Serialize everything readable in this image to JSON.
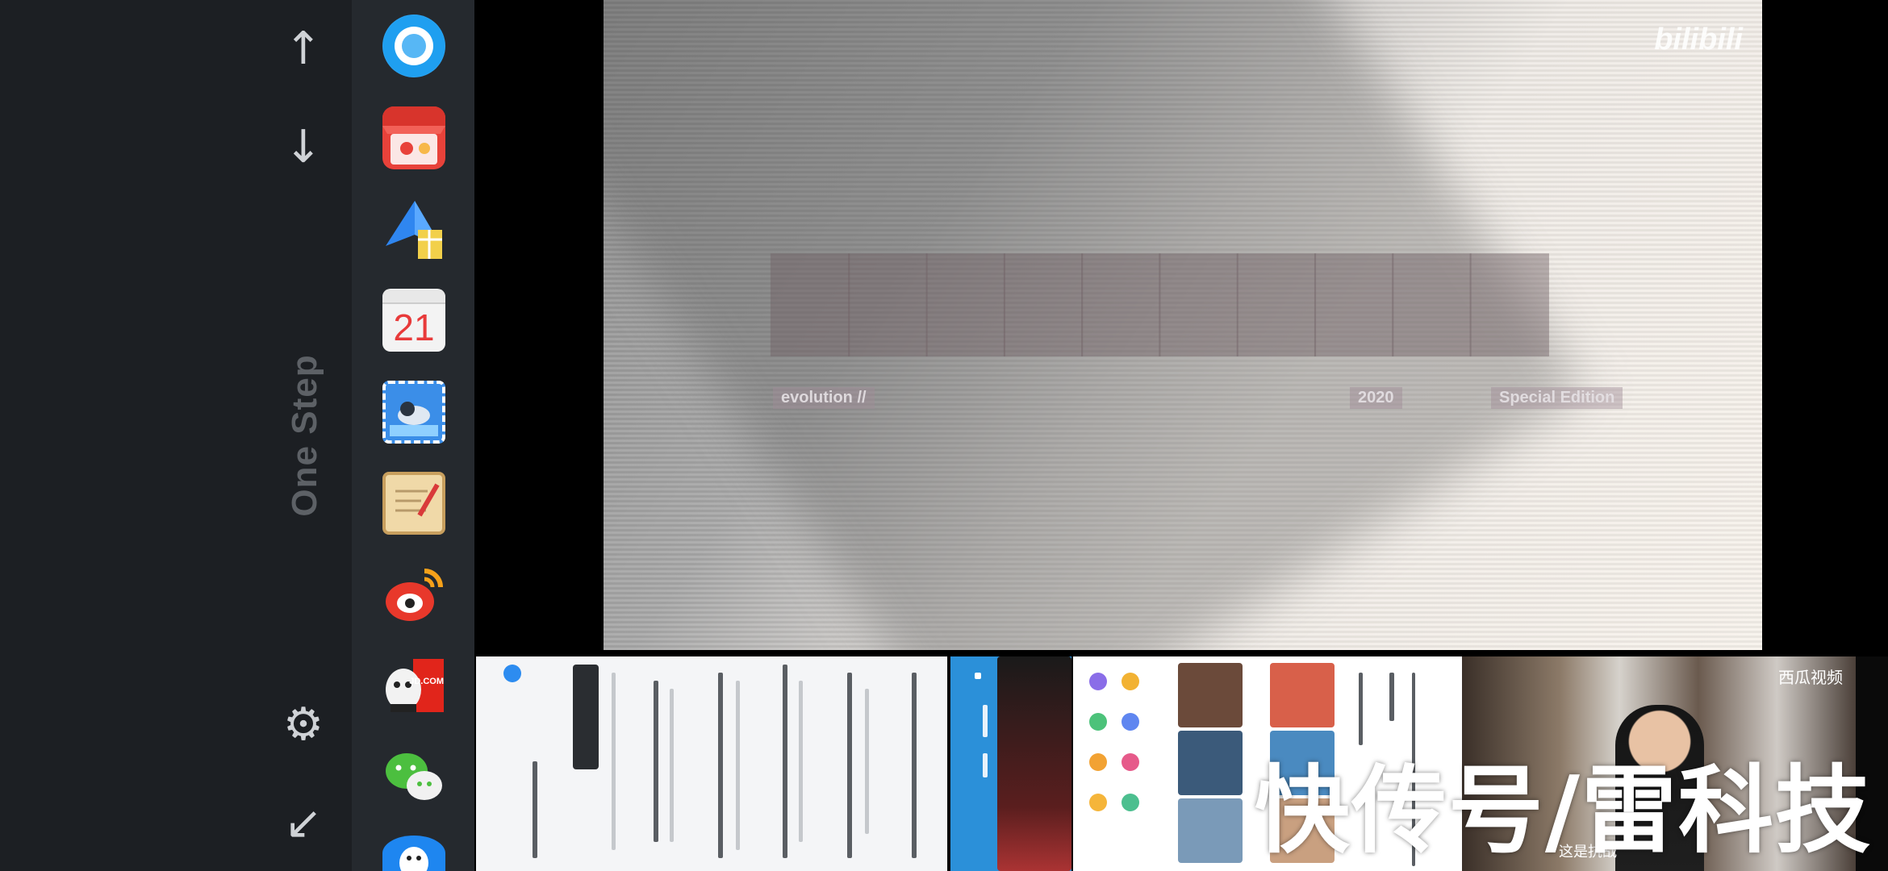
{
  "left_panel": {
    "brand_text": "One Step",
    "controls": {
      "up_arrow": "↑",
      "down_arrow": "↓",
      "settings": "⚙",
      "shrink_arrow": "↙"
    }
  },
  "dock": {
    "apps": [
      {
        "name": "browser",
        "color": "#2aa4f4"
      },
      {
        "name": "taobao-shop",
        "color": "#e8423a"
      },
      {
        "name": "maps",
        "color": "#3a8ef6"
      },
      {
        "name": "calendar",
        "day": "21",
        "color": "#e83a3a"
      },
      {
        "name": "mail",
        "color": "#3b8ee8"
      },
      {
        "name": "notes",
        "color": "#f0d9a8"
      },
      {
        "name": "weibo",
        "color": "#e8382b"
      },
      {
        "name": "jd",
        "label": "JD.COM",
        "color": "#e1251b"
      },
      {
        "name": "wechat",
        "color": "#4cbf3f"
      },
      {
        "name": "qq",
        "color": "#1e86f0"
      }
    ]
  },
  "video": {
    "watermark": "bilibili",
    "caption_left": "evolution //",
    "caption_year": "2020",
    "caption_edition": "Special Edition",
    "colors": {
      "bg_light": "#f7f2ec",
      "bg_dark": "#8f8f8f"
    }
  },
  "recents": {
    "xigua_brand": "西瓜视频",
    "xigua_subtitle": "这是抗战"
  },
  "overlay_watermark": "快传号/雷科技"
}
